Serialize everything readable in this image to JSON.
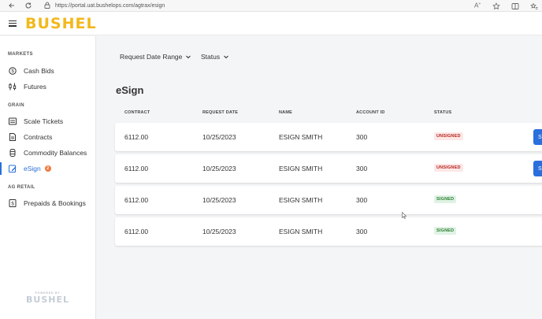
{
  "browser": {
    "url": "https://portal.uat.bushelops.com/agtrax/esign"
  },
  "header": {
    "logo_text": "BUSHEL",
    "brand_color": "#f2b81c"
  },
  "sidebar": {
    "sections": [
      {
        "label": "MARKETS"
      },
      {
        "label": "GRAIN"
      },
      {
        "label": "AG RETAIL"
      }
    ],
    "items": [
      {
        "label": "Cash Bids",
        "icon": "cash-bids-icon"
      },
      {
        "label": "Futures",
        "icon": "futures-icon"
      },
      {
        "label": "Scale Tickets",
        "icon": "scale-tickets-icon"
      },
      {
        "label": "Contracts",
        "icon": "contracts-icon"
      },
      {
        "label": "Commodity Balances",
        "icon": "commodity-balances-icon"
      },
      {
        "label": "eSign",
        "icon": "esign-icon",
        "active": true,
        "badge": "2"
      },
      {
        "label": "Prepaids & Bookings",
        "icon": "prepaids-icon"
      }
    ],
    "powered_small": "POWERED BY",
    "powered_logo": "BUSHEL"
  },
  "main": {
    "filters": [
      {
        "label": "Request Date Range"
      },
      {
        "label": "Status"
      }
    ],
    "title": "eSign",
    "table": {
      "columns": [
        "CONTRACT",
        "REQUEST DATE",
        "NAME",
        "ACCOUNT ID",
        "STATUS"
      ],
      "rows": [
        {
          "contract": "6112.00",
          "request_date": "10/25/2023",
          "name": "ESIGN SMITH",
          "account_id": "300",
          "status": "UNSIGNED"
        },
        {
          "contract": "6112.00",
          "request_date": "10/25/2023",
          "name": "ESIGN SMITH",
          "account_id": "300",
          "status": "UNSIGNED"
        },
        {
          "contract": "6112.00",
          "request_date": "10/25/2023",
          "name": "ESIGN SMITH",
          "account_id": "300",
          "status": "SIGNED"
        },
        {
          "contract": "6112.00",
          "request_date": "10/25/2023",
          "name": "ESIGN SMITH",
          "account_id": "300",
          "status": "SIGNED"
        }
      ],
      "row_action_label": "S"
    }
  },
  "colors": {
    "accent": "#2a6fdb",
    "unsigned": "#b3261e",
    "signed": "#2e7d32",
    "badge": "#f07b3f"
  }
}
